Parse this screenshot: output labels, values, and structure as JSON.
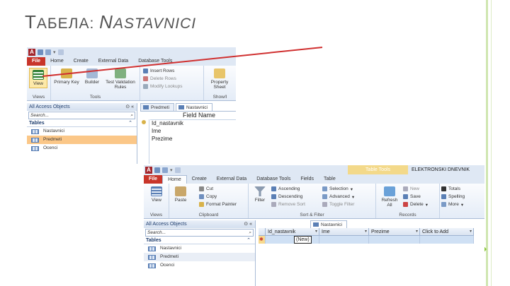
{
  "slide": {
    "title_first": "T",
    "title_rest": "АБЕЛА: ",
    "title_em_first": "N",
    "title_em_rest": "ASTAVNICI"
  },
  "colors": {
    "accent_green": "#8dc63f",
    "file_red": "#c8352a",
    "selection_orange": "#fbc788",
    "arrow_red": "#d03030"
  },
  "win1": {
    "tabs": [
      "File",
      "Home",
      "Create",
      "External Data",
      "Database Tools"
    ],
    "groups": {
      "views_label": "Views",
      "view_label": "View",
      "primary_key": "Primary Key",
      "builder": "Builder",
      "test_validation": "Test Validation Rules",
      "tools_label": "Tools",
      "insert_rows": "Insert Rows",
      "delete_rows": "Delete Rows",
      "modify_lookups": "Modify Lookups",
      "property_sheet": "Property Sheet",
      "show_label": "Show/I"
    },
    "nav": {
      "header": "All Access Objects",
      "search_placeholder": "Search...",
      "group": "Tables",
      "items": [
        "Nastavnici",
        "Predmeti",
        "Ocenci"
      ]
    },
    "doc_tabs": [
      "Predmeti",
      "Nastavnici"
    ],
    "field_name_header": "Field Name",
    "fields": [
      "Id_nastavnik",
      "Ime",
      "Prezime"
    ]
  },
  "win2": {
    "context_tab": "Table Tools",
    "app_title": "ELEKTRONSKI DNEVNIK",
    "tabs": [
      "File",
      "Home",
      "Create",
      "External Data",
      "Database Tools",
      "Fields",
      "Table"
    ],
    "groups": {
      "view": "View",
      "views_label": "Views",
      "paste": "Paste",
      "cut": "Cut",
      "copy": "Copy",
      "format_painter": "Format Painter",
      "clipboard_label": "Clipboard",
      "filter": "Filter",
      "ascending": "Ascending",
      "descending": "Descending",
      "remove_sort": "Remove Sort",
      "selection": "Selection",
      "advanced": "Advanced",
      "toggle_filter": "Toggle Filter",
      "sort_filter_label": "Sort & Filter",
      "refresh": "Refresh All",
      "new": "New",
      "save": "Save",
      "delete": "Delete",
      "records_label": "Records",
      "totals": "Totals",
      "spelling": "Spelling",
      "more": "More"
    },
    "nav": {
      "header": "All Access Objects",
      "search_placeholder": "Search...",
      "group": "Tables",
      "items": [
        "Nastavnici",
        "Predmeti",
        "Ocenci"
      ]
    },
    "doc_tab": "Nastavnici",
    "columns": [
      "Id_nastavnik",
      "Ime",
      "Prezime",
      "Click to Add"
    ],
    "new_row_marker": "✱",
    "new_row_value": "(New)"
  }
}
